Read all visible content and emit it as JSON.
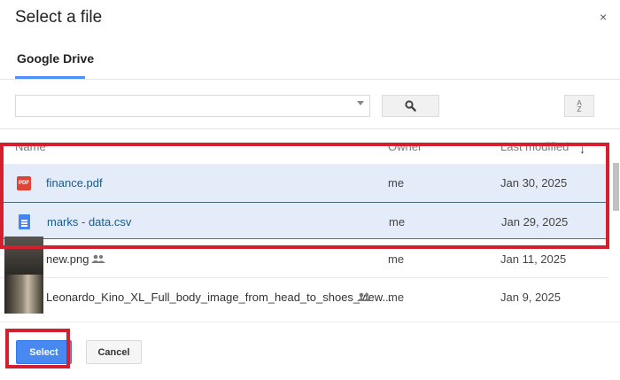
{
  "dialog": {
    "title": "Select a file",
    "close_glyph": "×"
  },
  "tabs": [
    {
      "label": "Google Drive",
      "active": true
    }
  ],
  "search": {
    "value": "",
    "placeholder": "",
    "search_icon": "search-icon",
    "sort_icon": "A\nZ"
  },
  "columns": {
    "name": "Name",
    "owner": "Owner",
    "modified": "Last modified"
  },
  "files": [
    {
      "name": "finance.pdf",
      "owner": "me",
      "modified": "Jan 30, 2025",
      "icon": "pdf-icon",
      "selected": true
    },
    {
      "name": "marks - data.csv",
      "owner": "me",
      "modified": "Jan 29, 2025",
      "icon": "document-icon",
      "selected": true
    },
    {
      "name": "new.png",
      "owner": "me",
      "modified": "Jan 11, 2025",
      "icon": "image-thumbnail",
      "shared": true,
      "selected": false
    },
    {
      "name": "Leonardo_Kino_XL_Full_body_image_from_head_to_shoes_view...",
      "owner": "me",
      "modified": "Jan 9, 2025",
      "icon": "image-thumbnail",
      "shared": true,
      "selected": false
    }
  ],
  "footer": {
    "select_label": "Select",
    "cancel_label": "Cancel"
  },
  "colors": {
    "accent": "#4d90fe",
    "selected_row": "#e3ecf8",
    "annotation": "#d41f2e",
    "select_button": "#4889f1"
  }
}
